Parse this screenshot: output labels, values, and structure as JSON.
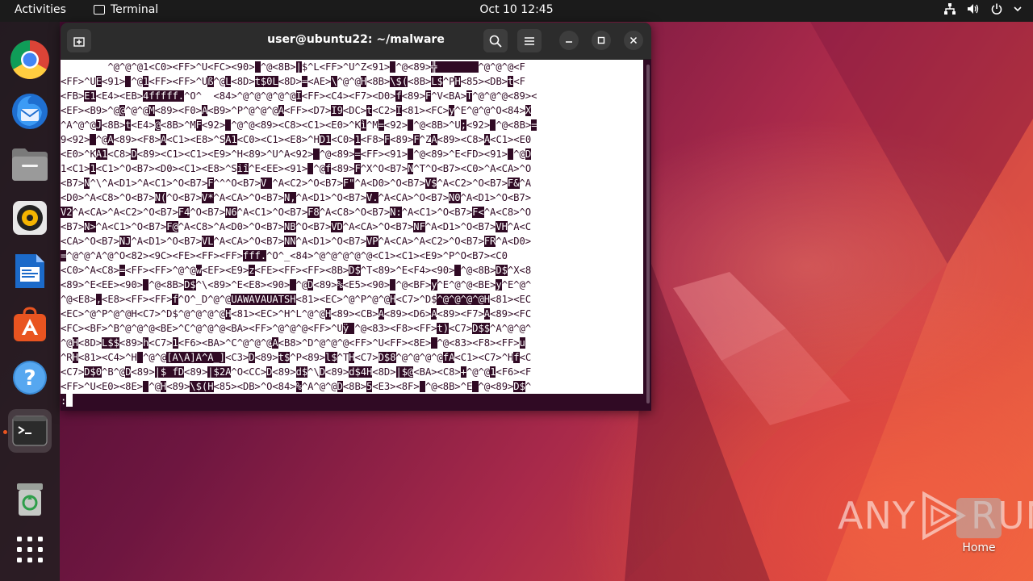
{
  "topbar": {
    "activities": "Activities",
    "app_name": "Terminal",
    "clock": "Oct 10  12:45"
  },
  "dock": {
    "items": [
      "Google Chrome",
      "Thunderbird Mail",
      "Files",
      "Rhythmbox",
      "LibreOffice Writer",
      "Ubuntu Software",
      "Help",
      "Terminal",
      "Trash",
      "Show Applications"
    ]
  },
  "window": {
    "title": "user@ubuntu22: ~/malware"
  },
  "terminal": {
    "lines": [
      [
        [
          "        ",
          0
        ],
        [
          "^@^@^@1<C0><FF>^U<FC><90>",
          0
        ],
        [
          " ",
          1
        ],
        [
          "^@<8B>",
          0
        ],
        [
          "|",
          1
        ],
        [
          "$^L<FF>^U^Z<91>",
          0
        ],
        [
          " ",
          1
        ],
        [
          "^@<89>",
          0
        ],
        [
          "╬       ",
          1
        ],
        [
          "^@^@^@<F",
          0
        ]
      ],
      [
        [
          "<FF>^U",
          0
        ],
        [
          "E",
          1
        ],
        [
          "<91>",
          0
        ],
        [
          " ",
          1
        ],
        [
          "^@",
          0
        ],
        [
          "1",
          1
        ],
        [
          "<FF><FF>^U",
          0
        ],
        [
          "ß",
          1
        ],
        [
          "^@",
          0
        ],
        [
          "L",
          1
        ],
        [
          "<8D>",
          0
        ],
        [
          "t$0L",
          1
        ],
        [
          "<8D>",
          0
        ],
        [
          "=",
          1
        ],
        [
          "<AE>",
          0
        ],
        [
          "\\",
          1
        ],
        [
          "^@^@",
          0
        ],
        [
          "H",
          1
        ],
        [
          "<8B>",
          0
        ],
        [
          "\\$(",
          1
        ],
        [
          "<8B>",
          0
        ],
        [
          "L$",
          1
        ],
        [
          "^P",
          0
        ],
        [
          "H",
          1
        ],
        [
          "<85><DB>",
          0
        ],
        [
          "t",
          1
        ],
        [
          "<F",
          0
        ]
      ],
      [
        [
          "<FB>",
          0
        ],
        [
          "E1",
          1
        ],
        [
          "<E4><EB>",
          0
        ],
        [
          "4fffff.",
          1
        ],
        [
          "^O^  <84>^@^@^@^@^@",
          0
        ],
        [
          "I",
          1
        ],
        [
          "<FF><C4><F7><D0>",
          0
        ],
        [
          "f",
          1
        ],
        [
          "<89>",
          0
        ],
        [
          "F",
          1
        ],
        [
          "^V<BA>",
          0
        ],
        [
          "T",
          1
        ],
        [
          "^@^@^@<89><",
          0
        ]
      ],
      [
        [
          "<EF><B9>^@",
          0
        ],
        [
          "@",
          1
        ],
        [
          "^@^@",
          0
        ],
        [
          "M",
          1
        ],
        [
          "<89><F0>",
          0
        ],
        [
          "A",
          1
        ],
        [
          "<B9>^P^@^@^@",
          0
        ],
        [
          "A",
          1
        ],
        [
          "<FF><D7>",
          0
        ],
        [
          "I9",
          1
        ],
        [
          "<DC>",
          0
        ],
        [
          "t",
          1
        ],
        [
          "<C2>",
          0
        ],
        [
          "I",
          1
        ],
        [
          "<81><FC>",
          0
        ],
        [
          "y",
          1
        ],
        [
          "^E^@^@^O<84>",
          0
        ],
        [
          "X",
          1
        ]
      ],
      [
        [
          "^A^@^@",
          0
        ],
        [
          "J",
          1
        ],
        [
          "<8B>",
          0
        ],
        [
          "t",
          1
        ],
        [
          "<E4>",
          0
        ],
        [
          "@",
          1
        ],
        [
          "<8B>^M",
          0
        ],
        [
          "F",
          1
        ],
        [
          "<92>",
          0
        ],
        [
          " ",
          1
        ],
        [
          "^@^@<89><C8><C1><E0>^K",
          0
        ],
        [
          "ì",
          1
        ],
        [
          "^M",
          0
        ],
        [
          "=",
          1
        ],
        [
          "<92>",
          0
        ],
        [
          " ",
          1
        ],
        [
          "^@<8B>^U",
          0
        ],
        [
          ";",
          1
        ],
        [
          "<92>",
          0
        ],
        [
          " ",
          1
        ],
        [
          "^@<8B>",
          0
        ],
        [
          "=",
          1
        ]
      ],
      [
        [
          "9<92>",
          0
        ],
        [
          " ",
          1
        ],
        [
          "^@",
          0
        ],
        [
          "A",
          1
        ],
        [
          "<89><F8>",
          0
        ],
        [
          "A",
          1
        ],
        [
          "<C1><E8>^S",
          0
        ],
        [
          "A1",
          1
        ],
        [
          "<C0><C1><E8>^H",
          0
        ],
        [
          "D1",
          1
        ],
        [
          "<C0>",
          0
        ],
        [
          "1",
          1
        ],
        [
          "<F8>",
          0
        ],
        [
          "F",
          1
        ],
        [
          "<89>",
          0
        ],
        [
          "F",
          1
        ],
        [
          "^Z",
          0
        ],
        [
          "A",
          1
        ],
        [
          "<89><C8>",
          0
        ],
        [
          "A",
          1
        ],
        [
          "<C1><E0",
          0
        ]
      ],
      [
        [
          "<E0>^K",
          0
        ],
        [
          "A1",
          1
        ],
        [
          "<C8>",
          0
        ],
        [
          "D",
          1
        ],
        [
          "<89><C1><C1><E9>^H<89>^U^A<92>",
          0
        ],
        [
          " ",
          1
        ],
        [
          "^@<89>",
          0
        ],
        [
          "=",
          1
        ],
        [
          "<FF><91>",
          0
        ],
        [
          " ",
          1
        ],
        [
          "^@<89>^E<FD><91>",
          0
        ],
        [
          " ",
          1
        ],
        [
          "^@",
          0
        ],
        [
          "D",
          1
        ]
      ],
      [
        [
          "1<C1>",
          0
        ],
        [
          "1",
          1
        ],
        [
          "<C1>^O<B7><D0><C1><E8>^S",
          0
        ],
        [
          "iî",
          1
        ],
        [
          "^E<EE><91>",
          0
        ],
        [
          " ",
          1
        ],
        [
          "^@",
          0
        ],
        [
          "f",
          1
        ],
        [
          "<89>",
          0
        ],
        [
          "F",
          1
        ],
        [
          "^X^O<B7>",
          0
        ],
        [
          "N",
          1
        ],
        [
          "^T^O<B7><C0>^A<CA>^O",
          0
        ]
      ],
      [
        [
          "<B7>",
          0
        ],
        [
          "N",
          1
        ],
        [
          "^\\^A<D1>^A<C1>^O<B7>",
          0
        ],
        [
          "F",
          1
        ],
        [
          "^^^O<B7>",
          0
        ],
        [
          "V ",
          1
        ],
        [
          "^A<C2>^O<B7>",
          0
        ],
        [
          "F\"",
          1
        ],
        [
          "^A<D0>^O<B7>",
          0
        ],
        [
          "V$",
          1
        ],
        [
          "^A<C2>^O<B7>",
          0
        ],
        [
          "F&",
          1
        ],
        [
          "^A",
          0
        ]
      ],
      [
        [
          "<D0>^A<C8>^O<B7>",
          0
        ],
        [
          "N(",
          1
        ],
        [
          "^O<B7>",
          0
        ],
        [
          "V*",
          1
        ],
        [
          "^A<CA>^O<B7>",
          0
        ],
        [
          "N,",
          1
        ],
        [
          "^A<D1>^O<B7>",
          0
        ],
        [
          "V.",
          1
        ],
        [
          "^A<CA>^O<B7>",
          0
        ],
        [
          "N0",
          1
        ],
        [
          "^A<D1>^O<B7>",
          0
        ]
      ],
      [
        [
          "V2",
          1
        ],
        [
          "^A<CA>^A<C2>^O<B7>",
          0
        ],
        [
          "F4",
          1
        ],
        [
          "^O<B7>",
          0
        ],
        [
          "N6",
          1
        ],
        [
          "^A<C1>^O<B7>",
          0
        ],
        [
          "F8",
          1
        ],
        [
          "^A<C8>^O<B7>",
          0
        ],
        [
          "N:",
          1
        ],
        [
          "^A<C1>^O<B7>",
          0
        ],
        [
          "F<",
          1
        ],
        [
          "^A<C8>^O",
          0
        ]
      ],
      [
        [
          "<B7>",
          0
        ],
        [
          "N>",
          1
        ],
        [
          "^A<C1>^O<B7>",
          0
        ],
        [
          "F@",
          1
        ],
        [
          "^A<C8>^A<D0>^O<B7>",
          0
        ],
        [
          "NB",
          1
        ],
        [
          "^O<B7>",
          0
        ],
        [
          "VD",
          1
        ],
        [
          "^A<CA>^O<B7>",
          0
        ],
        [
          "NF",
          1
        ],
        [
          "^A<D1>^O<B7>",
          0
        ],
        [
          "VH",
          1
        ],
        [
          "^A<C",
          0
        ]
      ],
      [
        [
          "<CA>^O<B7>",
          0
        ],
        [
          "NJ",
          1
        ],
        [
          "^A<D1>^O<B7>",
          0
        ],
        [
          "VL",
          1
        ],
        [
          "^A<CA>^O<B7>",
          0
        ],
        [
          "NN",
          1
        ],
        [
          "^A<D1>^O<B7>",
          0
        ],
        [
          "VP",
          1
        ],
        [
          "^A<CA>^A<C2>^O<B7>",
          0
        ],
        [
          "FR",
          1
        ],
        [
          "^A<D0>",
          0
        ]
      ],
      [
        [
          "=",
          1
        ],
        [
          "^@^@^A^@^O<82><9C><FE><FF><FF>",
          0
        ],
        [
          "fff.",
          1
        ],
        [
          "^O^_<84>^@^@^@^@^@<C1><C1><E9>^P^O<B7><C0",
          0
        ]
      ],
      [
        [
          "<C0>^A<C8>",
          0
        ],
        [
          "=",
          1
        ],
        [
          "<FF><FF>^@^@",
          0
        ],
        [
          "w",
          1
        ],
        [
          "<EF><E9>",
          0
        ],
        [
          "z",
          1
        ],
        [
          "<FE><FF><FF><8B>",
          0
        ],
        [
          "D$",
          1
        ],
        [
          "^T<89>^E<F4><90>",
          0
        ],
        [
          " ",
          1
        ],
        [
          "^@<8B>",
          0
        ],
        [
          "D$",
          1
        ],
        [
          "^X<8",
          0
        ]
      ],
      [
        [
          "<89>^E<EE><90>",
          0
        ],
        [
          " ",
          1
        ],
        [
          "^@<8B>",
          0
        ],
        [
          "D$",
          1
        ],
        [
          "^\\<89>^E<E8><90>",
          0
        ],
        [
          " ",
          1
        ],
        [
          "^@",
          0
        ],
        [
          "D",
          1
        ],
        [
          "<89>",
          0
        ],
        [
          "%",
          1
        ],
        [
          "<E5><90>",
          0
        ],
        [
          " ",
          1
        ],
        [
          "^@<BF>",
          0
        ],
        [
          "y",
          1
        ],
        [
          "^E^@^@<BE>",
          0
        ],
        [
          "y",
          1
        ],
        [
          "^E^@^",
          0
        ]
      ],
      [
        [
          "^@<E8>",
          0
        ],
        [
          ",",
          1
        ],
        [
          "<E8><FF><FF>",
          0
        ],
        [
          "f",
          1
        ],
        [
          "^O^_D^@^@",
          0
        ],
        [
          "UAWAVAUATSH",
          1
        ],
        [
          "<81><EC>^@^P^@^@",
          0
        ],
        [
          "H",
          1
        ],
        [
          "<C7>^D$",
          0
        ],
        [
          "^@^@^@^@",
          1
        ],
        [
          "H",
          1
        ],
        [
          "<81><EC",
          0
        ]
      ],
      [
        [
          "<EC>^@^P^@^@H<C7>^D$^@^@^@^@",
          0
        ],
        [
          "H",
          1
        ],
        [
          "<81><EC>^H^L^@^@",
          0
        ],
        [
          "H",
          1
        ],
        [
          "<89><CB>",
          0
        ],
        [
          "A",
          1
        ],
        [
          "<89><D6>",
          0
        ],
        [
          "A",
          1
        ],
        [
          "<89><F7>",
          0
        ],
        [
          "A",
          1
        ],
        [
          "<89><FC",
          0
        ]
      ],
      [
        [
          "<FC><BF>^B^@^@^@<BE>^C^@^@^@<BA><FF>^@^@^@<FF>^U",
          0
        ],
        [
          "ÿ",
          1
        ],
        [
          " ",
          1
        ],
        [
          "^@<83><F8><FF>",
          0
        ],
        [
          "t)",
          1
        ],
        [
          "<C7>",
          0
        ],
        [
          "D$$",
          1
        ],
        [
          "^A^@^@^",
          0
        ]
      ],
      [
        [
          "^@",
          0
        ],
        [
          "H",
          1
        ],
        [
          "<8D>",
          0
        ],
        [
          "L$$",
          1
        ],
        [
          "<89>",
          0
        ],
        [
          "h",
          1
        ],
        [
          "<C7>",
          0
        ],
        [
          "1",
          1
        ],
        [
          "<F6><BA>^C^@^@^@",
          0
        ],
        [
          "A",
          1
        ],
        [
          "<B8>^D^@^@^@<FF>^U<FF><8E>",
          0
        ],
        [
          " ",
          1
        ],
        [
          "^@<83><F8><FF>",
          0
        ],
        [
          "u",
          1
        ]
      ],
      [
        [
          "^R",
          0
        ],
        [
          "H",
          1
        ],
        [
          "<81><C4>^H",
          0
        ],
        [
          " ",
          1
        ],
        [
          "^@^@",
          0
        ],
        [
          "[A\\A]A^A_]",
          1
        ],
        [
          "<C3>",
          0
        ],
        [
          "D",
          1
        ],
        [
          "<89>",
          0
        ],
        [
          "t$",
          1
        ],
        [
          "^P<89>",
          0
        ],
        [
          "l$",
          1
        ],
        [
          "^T",
          0
        ],
        [
          "H",
          1
        ],
        [
          "<C7>",
          0
        ],
        [
          "D$8",
          1
        ],
        [
          "^@^@^@^@",
          0
        ],
        [
          "fA",
          1
        ],
        [
          "<C1><C7>^H",
          0
        ],
        [
          "f",
          1
        ],
        [
          "<C",
          0
        ]
      ],
      [
        [
          "<C7>",
          0
        ],
        [
          "D$0",
          1
        ],
        [
          "^B^@",
          0
        ],
        [
          "D",
          1
        ],
        [
          "<89>",
          0
        ],
        [
          "|$ fD",
          1
        ],
        [
          "<89>",
          0
        ],
        [
          "|$2A",
          1
        ],
        [
          "^O<CC>",
          0
        ],
        [
          "D",
          1
        ],
        [
          "<89>",
          0
        ],
        [
          "d$",
          1
        ],
        [
          "^\\",
          0
        ],
        [
          "D",
          1
        ],
        [
          "<89>",
          0
        ],
        [
          "d$4H",
          1
        ],
        [
          "<8D>",
          0
        ],
        [
          "|$@",
          1
        ],
        [
          "<BA><C8>",
          0
        ],
        [
          "+",
          1
        ],
        [
          "^@^@",
          0
        ],
        [
          "1",
          1
        ],
        [
          "<F6><F",
          0
        ]
      ],
      [
        [
          "<FF>^U<E0><8E>",
          0
        ],
        [
          " ",
          1
        ],
        [
          "^@",
          0
        ],
        [
          "H",
          1
        ],
        [
          "<89>",
          0
        ],
        [
          "\\$(H",
          1
        ],
        [
          "<85><DB>^O<84>",
          0
        ],
        [
          "%",
          1
        ],
        [
          "^A^@^@",
          0
        ],
        [
          "D",
          1
        ],
        [
          "<8B>",
          0
        ],
        [
          "5",
          1
        ],
        [
          "<E3><8F>",
          0
        ],
        [
          " ",
          1
        ],
        [
          "^@<8B>^E",
          0
        ],
        [
          " ",
          1
        ],
        [
          "^@<89>",
          0
        ],
        [
          "D$",
          1
        ],
        [
          "^",
          0
        ]
      ]
    ],
    "prompt": ":"
  },
  "watermark": {
    "text_left": "ANY",
    "text_right": "RUN"
  },
  "desktop_icon": {
    "label": "Home"
  }
}
